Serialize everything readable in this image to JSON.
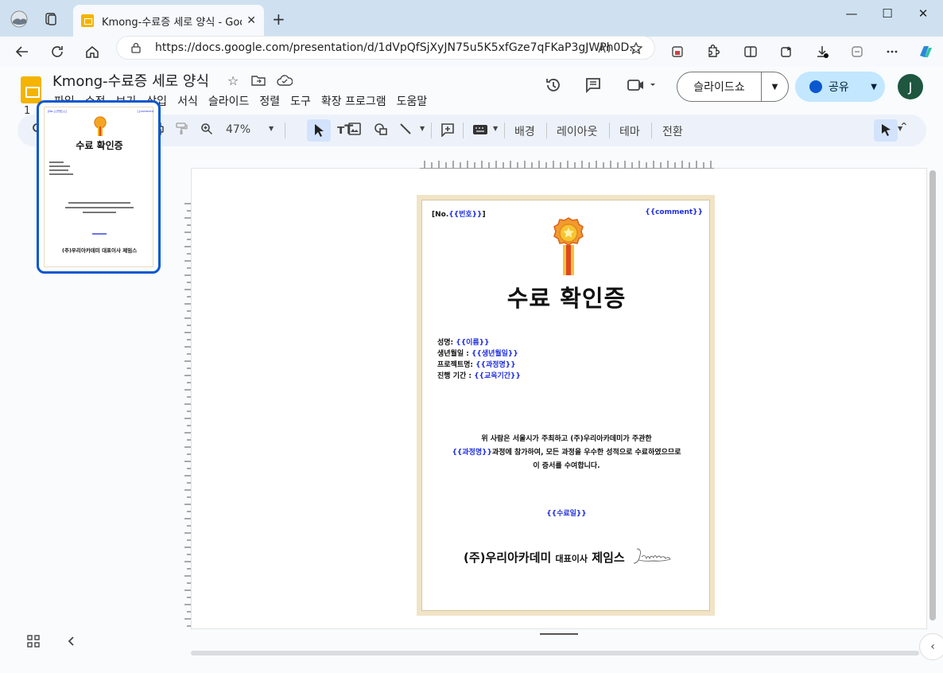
{
  "browser": {
    "tab_title": "Kmong-수료증 세로 양식 - Goog",
    "tab_close": "✕",
    "new_tab": "+",
    "url": "https://docs.google.com/presentation/d/1dVpQfSjXyJN75u5K5xfGze7qFKaP3gJWPh0D...",
    "window_controls": [
      "—",
      "☐",
      "✕"
    ]
  },
  "app": {
    "doc_title": "Kmong-수료증 세로 양식",
    "menu": [
      "파일",
      "수정",
      "보기",
      "삽입",
      "서식",
      "슬라이드",
      "정렬",
      "도구",
      "확장 프로그램",
      "도움말"
    ],
    "slideshow_label": "슬라이드쇼",
    "share_label": "공유",
    "avatar_initial": "J"
  },
  "toolbar": {
    "zoom": "47%",
    "background_label": "배경",
    "layout_label": "레이아웃",
    "theme_label": "테마",
    "transition_label": "전환"
  },
  "filmstrip": {
    "slide_number": "1"
  },
  "slide": {
    "no_label": "[No.",
    "no_value": "{{번호}}",
    "no_close": "]",
    "comment": "{{comment}}",
    "title": "수료 확인증",
    "fields": [
      {
        "label": "성명: ",
        "value": "{{이름}}"
      },
      {
        "label": "생년월일 : ",
        "value": "{{생년월일}}"
      },
      {
        "label": "프로젝트명:  ",
        "value": "{{과정명}}"
      },
      {
        "label": "진행 기간 :  ",
        "value": "{{교육기간}}"
      }
    ],
    "body_line1": "위 사람은 서울시가 주최하고 (주)우리아카데미가 주관한",
    "body_line2_var": "{{과정명}}",
    "body_line2_text": "과정에 참가하여, 모든 과정을 우수한 성적으로 수료하였으므로",
    "body_line3": "이 증서를 수여합니다.",
    "date": "{{수료일}}",
    "company": "(주)우리아카데미",
    "ceo_title": "대표이사",
    "ceo_name": "제임스",
    "signature": "James"
  },
  "colors": {
    "placeholder_blue": "#1f2ee0",
    "accent_blue": "#0b57d0",
    "share_bg": "#c2e7ff",
    "avatar_bg": "#1e5640",
    "slides_logo": "#f4b400",
    "certificate_border": "#f1e4c6"
  }
}
